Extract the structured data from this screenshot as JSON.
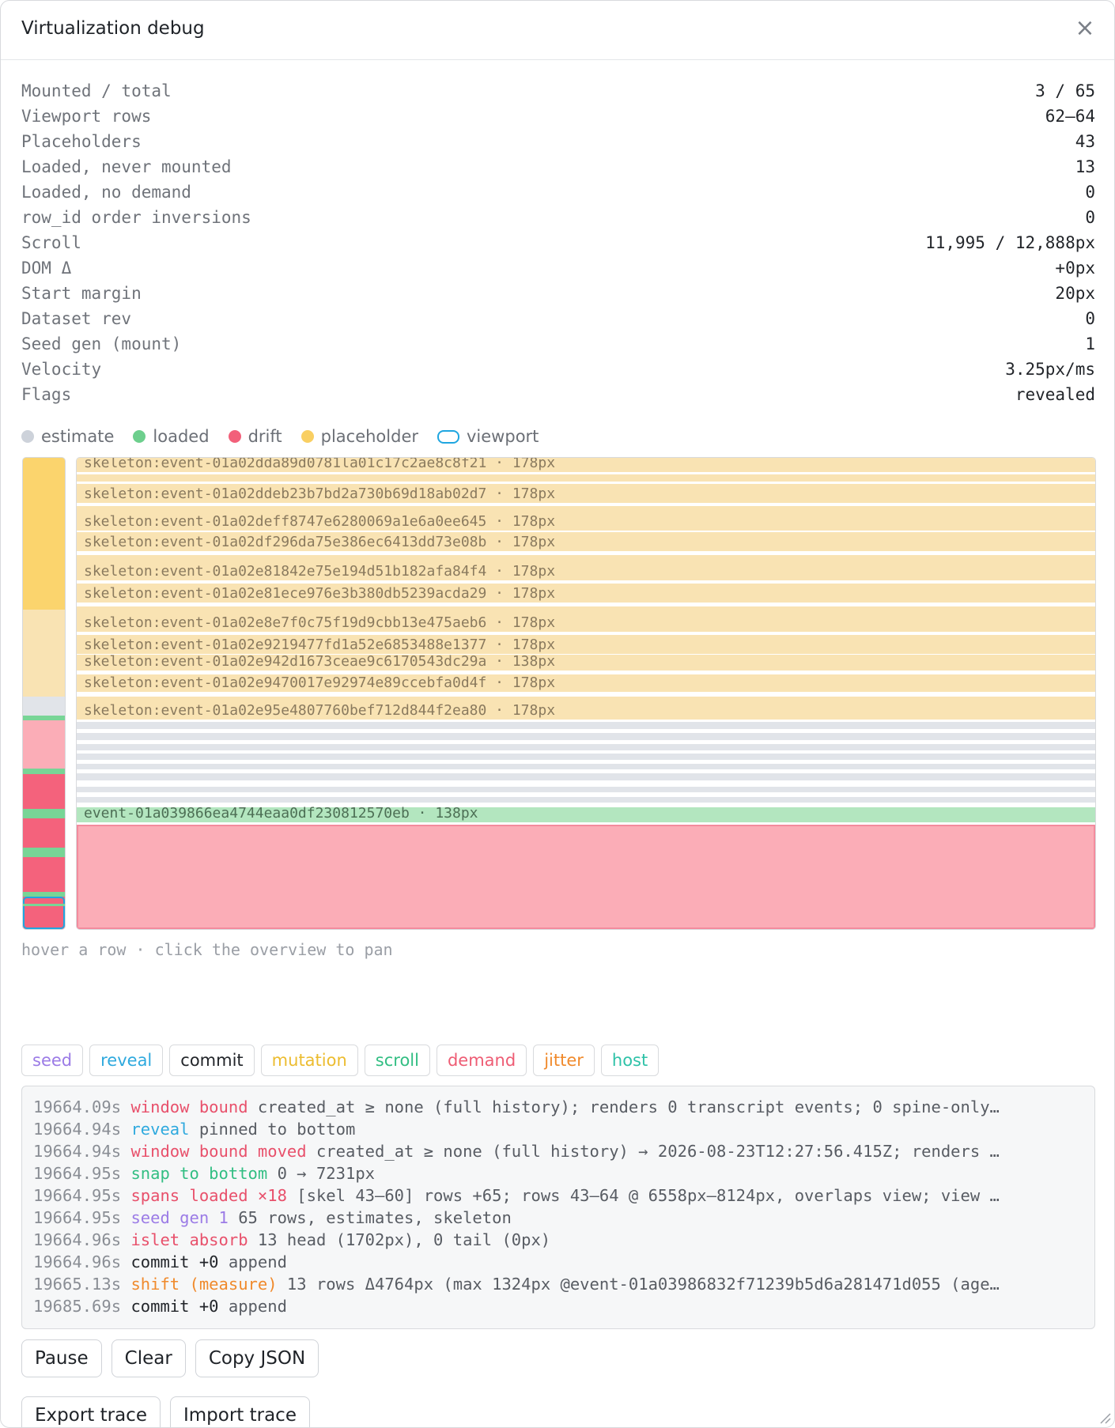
{
  "header": {
    "title": "Virtualization debug",
    "close_symbol": "×"
  },
  "stats": [
    {
      "label": "Mounted / total",
      "value": "3 / 65"
    },
    {
      "label": "Viewport rows",
      "value": "62–64"
    },
    {
      "label": "Placeholders",
      "value": "43"
    },
    {
      "label": "Loaded, never mounted",
      "value": "13"
    },
    {
      "label": "Loaded, no demand",
      "value": "0"
    },
    {
      "label": "row_id order inversions",
      "value": "0"
    },
    {
      "label": "Scroll",
      "value": "11,995 / 12,888px"
    },
    {
      "label": "DOM Δ",
      "value": "+0px"
    },
    {
      "label": "Start margin",
      "value": "20px"
    },
    {
      "label": "Dataset rev",
      "value": "0"
    },
    {
      "label": "Seed gen (mount)",
      "value": "1"
    },
    {
      "label": "Velocity",
      "value": "3.25px/ms"
    },
    {
      "label": "Flags",
      "value": "revealed"
    }
  ],
  "legend": [
    {
      "label": "estimate",
      "color": "#cdd2da",
      "shape": "dot"
    },
    {
      "label": "loaded",
      "color": "#6dcf8d",
      "shape": "dot"
    },
    {
      "label": "drift",
      "color": "#f2607a",
      "shape": "dot"
    },
    {
      "label": "placeholder",
      "color": "#f9cf62",
      "shape": "dot"
    },
    {
      "label": "viewport",
      "color": "#1fa6e0",
      "shape": "pill"
    }
  ],
  "colors": {
    "placeholder": "#f9e3b3",
    "placeholder_strong": "#fbd46d",
    "estimate": "#e1e4e9",
    "loaded": "#b3e6bf",
    "loaded_strong": "#78d596",
    "drift": "#fbadb7",
    "drift_strong": "#f4627c",
    "viewport": "#1fa6e0"
  },
  "rows": [
    {
      "kind": "placeholder",
      "label": "skeleton:event-01a02dda89d0781la01c17c2ae8c8f21 · 178px"
    },
    {
      "kind": "placeholder",
      "label": ""
    },
    {
      "kind": "placeholder",
      "label": "skeleton:event-01a02ddeb23b7bd2a730b69d18ab02d7 · 178px"
    },
    {
      "kind": "placeholder",
      "label": ""
    },
    {
      "kind": "placeholder",
      "label": "skeleton:event-01a02deff8747e6280069a1e6a0ee645 · 178px"
    },
    {
      "kind": "placeholder",
      "label": "skeleton:event-01a02df296da75e386ec6413dd73e08b · 178px"
    },
    {
      "kind": "placeholder",
      "label": ""
    },
    {
      "kind": "placeholder",
      "label": "skeleton:event-01a02e81842e75e194d51b182afa84f4 · 178px"
    },
    {
      "kind": "placeholder",
      "label": "skeleton:event-01a02e81ece976e3b380db5239acda29 · 178px"
    },
    {
      "kind": "placeholder",
      "label": ""
    },
    {
      "kind": "placeholder",
      "label": "skeleton:event-01a02e8e7f0c75f19d9cbb13e475aeb6 · 178px"
    },
    {
      "kind": "placeholder",
      "label": "skeleton:event-01a02e9219477fd1a52e6853488e1377 · 178px"
    },
    {
      "kind": "placeholder",
      "label": "skeleton:event-01a02e942d1673ceae9c6170543dc29a · 138px"
    },
    {
      "kind": "placeholder",
      "label": "skeleton:event-01a02e9470017e92974e89ccebfa0d4f · 178px"
    },
    {
      "kind": "placeholder",
      "label": ""
    },
    {
      "kind": "placeholder",
      "label": "skeleton:event-01a02e95e4807760bef712d844f2ea80 · 178px"
    },
    {
      "kind": "estimate",
      "label": ""
    },
    {
      "kind": "estimate",
      "label": ""
    },
    {
      "kind": "estimate",
      "label": ""
    },
    {
      "kind": "estimate",
      "label": ""
    },
    {
      "kind": "estimate",
      "label": ""
    },
    {
      "kind": "estimate",
      "label": ""
    },
    {
      "kind": "estimate",
      "label": ""
    },
    {
      "kind": "estimate",
      "label": ""
    },
    {
      "kind": "loaded",
      "label": "event-01a039866ea4744eaa0df230812570eb · 138px"
    },
    {
      "kind": "drift",
      "label": ""
    }
  ],
  "overview": [
    {
      "kind": "placeholder_strong"
    },
    {
      "kind": "placeholder_strong"
    },
    {
      "kind": "placeholder_strong"
    },
    {
      "kind": "placeholder_strong"
    },
    {
      "kind": "placeholder_strong"
    },
    {
      "kind": "placeholder_strong"
    },
    {
      "kind": "placeholder"
    },
    {
      "kind": "placeholder"
    },
    {
      "kind": "estimate"
    },
    {
      "kind": "loaded_strong"
    },
    {
      "kind": "drift"
    },
    {
      "kind": "loaded_strong"
    },
    {
      "kind": "drift_strong"
    },
    {
      "kind": "loaded_strong"
    },
    {
      "kind": "drift_strong"
    },
    {
      "kind": "loaded_strong"
    },
    {
      "kind": "drift_strong"
    },
    {
      "kind": "loaded_strong"
    },
    {
      "kind": "drift_strong"
    }
  ],
  "hint": "hover a row · click the overview to pan",
  "filters": [
    {
      "label": "seed",
      "color": "#9b7be6"
    },
    {
      "label": "reveal",
      "color": "#2ea9de"
    },
    {
      "label": "commit",
      "color": "#22252a"
    },
    {
      "label": "mutation",
      "color": "#ecbc2f"
    },
    {
      "label": "scroll",
      "color": "#32be83"
    },
    {
      "label": "demand",
      "color": "#ee5c74"
    },
    {
      "label": "jitter",
      "color": "#f08a2c"
    },
    {
      "label": "host",
      "color": "#2ec2a8"
    }
  ],
  "log": [
    {
      "time": "19664.09s",
      "tag": "window bound",
      "tag_color": "#e8506b",
      "text": "created_at ≥ none (full history); renders 0 transcript events; 0 spine-only…"
    },
    {
      "time": "19664.94s",
      "tag": "reveal",
      "tag_color": "#2ea9de",
      "text": "pinned to bottom"
    },
    {
      "time": "19664.94s",
      "tag": "window bound moved",
      "tag_color": "#e8506b",
      "text": "created_at ≥ none (full history) → 2026-08-23T12:27:56.415Z; renders …"
    },
    {
      "time": "19664.95s",
      "tag": "snap to bottom",
      "tag_color": "#32be83",
      "text": "0 → 7231px"
    },
    {
      "time": "19664.95s",
      "tag": "spans loaded ×18",
      "tag_color": "#e8506b",
      "text": "[skel 43–60] rows +65; rows 43–64 @ 6558px–8124px, overlaps view; view …"
    },
    {
      "time": "19664.95s",
      "tag": "seed gen 1",
      "tag_color": "#9b7be6",
      "text": "65 rows, estimates, skeleton"
    },
    {
      "time": "19664.96s",
      "tag": "islet absorb",
      "tag_color": "#e8506b",
      "text": "13 head (1702px), 0 tail (0px)"
    },
    {
      "time": "19664.96s",
      "tag": "commit +0",
      "tag_color": "#22252a",
      "text": "append"
    },
    {
      "time": "19665.13s",
      "tag": "shift (measure)",
      "tag_color": "#f08a2c",
      "text": "13 rows Δ4764px (max 1324px @event-01a03986832f71239b5d6a281471d055 (age…"
    },
    {
      "time": "19685.69s",
      "tag": "commit +0",
      "tag_color": "#22252a",
      "text": "append"
    }
  ],
  "buttons_row1": [
    {
      "label": "Pause"
    },
    {
      "label": "Clear"
    },
    {
      "label": "Copy JSON"
    }
  ],
  "buttons_row2": [
    {
      "label": "Export trace"
    },
    {
      "label": "Import trace"
    }
  ]
}
